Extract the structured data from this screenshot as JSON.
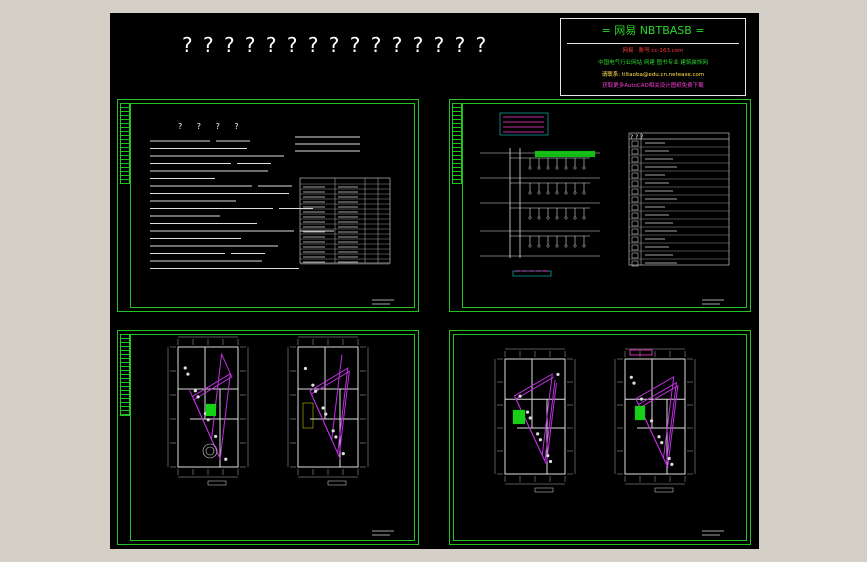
{
  "drawing": {
    "header_placeholder": "? ? ? ? ? ? ? ? ? ? ? ? ? ? ?",
    "sheet1_title": "? ? ? ?",
    "table_header": [
      "? ?",
      "?",
      "?"
    ],
    "legend_title": "? ?             ?"
  },
  "title_block": {
    "brand": "= 网易  NBTBASB =",
    "line1": "网易 · 账号    cc-163.com",
    "line2": "中国电气行业网站 网建 图书专业  建筑装饰网",
    "line3": "请联系: tiltaoba@edu.cn.netease.com",
    "line4": "获取更多AutoCAD相关设计图纸免费下载",
    "colors": {
      "brand": "#2cd62c",
      "line1": "#ff3b3b",
      "line2": "#2cd62c",
      "line3": "#ffe14a",
      "line4": "#ff3bd9"
    }
  },
  "colors": {
    "background": "#000000",
    "app_frame": "#d4d0c8",
    "sheet_border": "#22c322",
    "wiring": "#c030e0",
    "drawing_lines": "#ffffff",
    "cyan": "#16d0d0",
    "yellow": "#e6e600"
  }
}
